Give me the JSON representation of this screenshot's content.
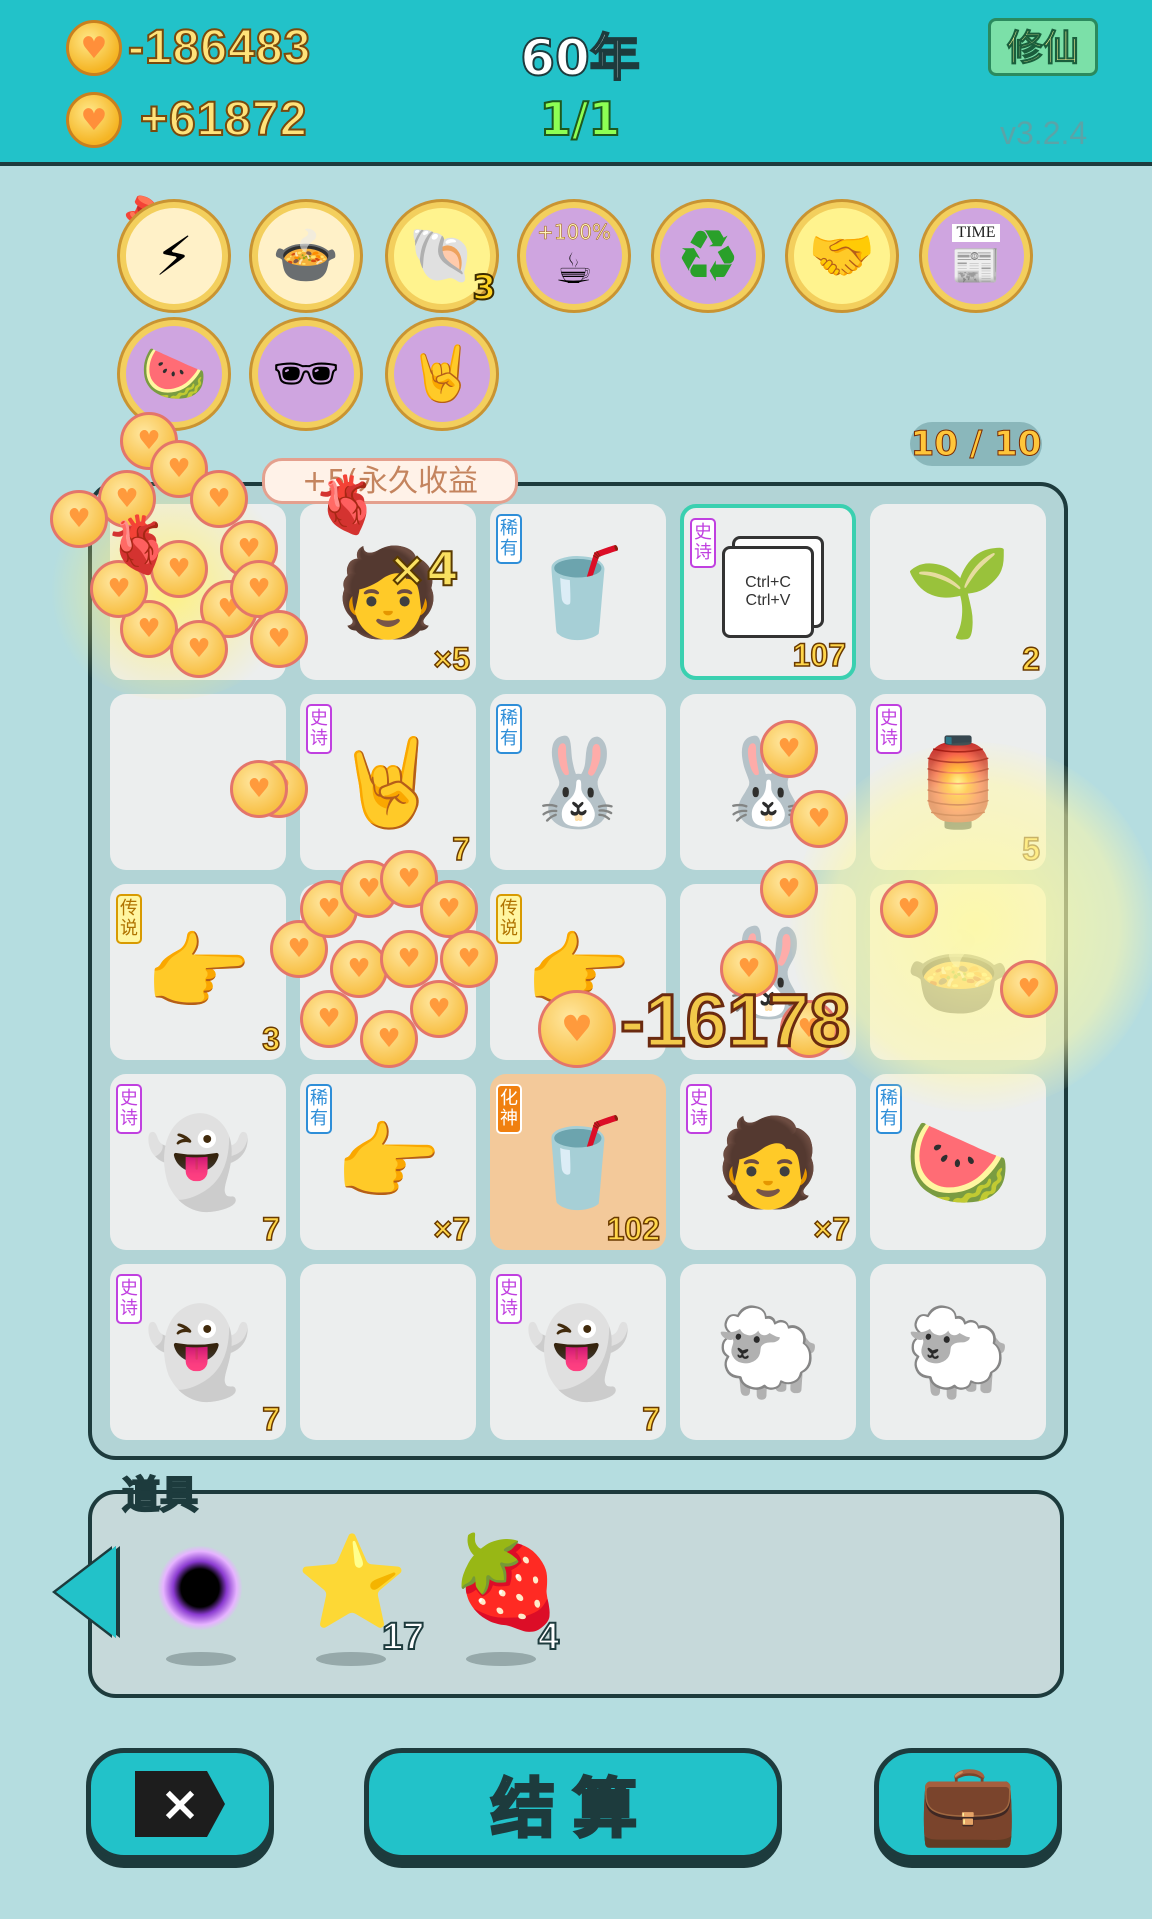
{
  "header": {
    "score": "-186483",
    "income": "+61872",
    "year": "60年",
    "round": "1/1",
    "cultivate_label": "修仙",
    "version": "v3.2.4"
  },
  "relics": [
    {
      "icon": "⚡",
      "badge": ""
    },
    {
      "icon": "🍲",
      "badge": ""
    },
    {
      "icon": "🐚",
      "badge": "3"
    },
    {
      "icon": "☕",
      "badge": "",
      "label": "+100%"
    },
    {
      "icon": "♻",
      "badge": ""
    },
    {
      "icon": "🤝",
      "badge": ""
    },
    {
      "icon": "📰",
      "badge": "",
      "label": "TIME"
    },
    {
      "icon": "🍉",
      "badge": ""
    },
    {
      "icon": "🕶",
      "badge": ""
    },
    {
      "icon": "🤘",
      "badge": ""
    }
  ],
  "board": {
    "capacity": "10 / 10",
    "income_banner": "+5(永久收益",
    "float_value": "-16178",
    "multiplier": "×4",
    "cells": [
      {
        "icon": "",
        "tag": "",
        "count": ""
      },
      {
        "icon": "🧑",
        "tag": "",
        "count": "×5"
      },
      {
        "icon": "🥤",
        "tag": "稀有",
        "tag_type": "rare",
        "count": ""
      },
      {
        "icon": "card",
        "tag": "史诗",
        "tag_type": "epic",
        "count": "107",
        "card_line1": "Ctrl+C",
        "card_line2": "Ctrl+V"
      },
      {
        "icon": "🌱",
        "tag": "",
        "count": "2"
      },
      {
        "icon": "",
        "tag": "",
        "count": ""
      },
      {
        "icon": "🤘",
        "tag": "史诗",
        "tag_type": "epic",
        "count": "7"
      },
      {
        "icon": "🐰",
        "tag": "稀有",
        "tag_type": "rare",
        "count": ""
      },
      {
        "icon": "🐰",
        "tag": "",
        "count": ""
      },
      {
        "icon": "🏮",
        "tag": "史诗",
        "tag_type": "epic",
        "count": "5"
      },
      {
        "icon": "👉",
        "tag": "传说",
        "tag_type": "legend",
        "count": "3"
      },
      {
        "icon": "",
        "tag": "",
        "count": ""
      },
      {
        "icon": "👉",
        "tag": "传说",
        "tag_type": "legend",
        "count": ""
      },
      {
        "icon": "🐰",
        "tag": "",
        "count": ""
      },
      {
        "icon": "🍲",
        "tag": "",
        "count": ""
      },
      {
        "icon": "👻",
        "tag": "史诗",
        "tag_type": "epic",
        "count": "7"
      },
      {
        "icon": "👉",
        "tag": "稀有",
        "tag_type": "rare",
        "count": "×7"
      },
      {
        "icon": "🥤",
        "tag": "化神",
        "tag_type": "huashen",
        "count": "102"
      },
      {
        "icon": "🧑",
        "tag": "史诗",
        "tag_type": "epic",
        "count": "×7"
      },
      {
        "icon": "🍉",
        "tag": "稀有",
        "tag_type": "rare",
        "count": ""
      },
      {
        "icon": "👻",
        "tag": "史诗",
        "tag_type": "epic",
        "count": "7"
      },
      {
        "icon": "",
        "tag": "",
        "count": ""
      },
      {
        "icon": "👻",
        "tag": "史诗",
        "tag_type": "epic",
        "count": "7"
      },
      {
        "icon": "🐑",
        "tag": "",
        "count": ""
      },
      {
        "icon": "🐑",
        "tag": "",
        "count": ""
      }
    ]
  },
  "items": {
    "label": "道具",
    "list": [
      {
        "name": "black-hole",
        "icon": "",
        "count": ""
      },
      {
        "name": "star",
        "icon": "⭐",
        "count": "17"
      },
      {
        "name": "strawberry",
        "icon": "🍓",
        "count": "4"
      }
    ]
  },
  "buttons": {
    "quit_label": "×",
    "settle_label": "结算",
    "bag_icon": "💼"
  },
  "colors": {
    "header_bg": "#22c2c9",
    "page_bg": "#b5dde0",
    "outline": "#1d3b3d",
    "coin_gold": "#f5b524",
    "epic": "#c040e0",
    "rare": "#2e8ed8",
    "legend": "#d89a00"
  }
}
